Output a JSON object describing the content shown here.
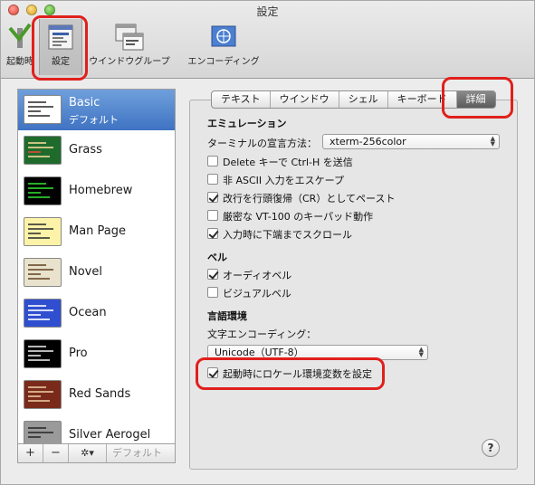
{
  "window": {
    "title": "設定"
  },
  "toolbar": {
    "items": [
      {
        "label": "起動時"
      },
      {
        "label": "設定"
      },
      {
        "label": "ウインドウグループ"
      },
      {
        "label": "エンコーディング"
      }
    ]
  },
  "profiles": [
    {
      "name": "Basic",
      "sub": "デフォルト"
    },
    {
      "name": "Grass"
    },
    {
      "name": "Homebrew"
    },
    {
      "name": "Man Page"
    },
    {
      "name": "Novel"
    },
    {
      "name": "Ocean"
    },
    {
      "name": "Pro"
    },
    {
      "name": "Red Sands"
    },
    {
      "name": "Silver Aerogel"
    }
  ],
  "list_bar": {
    "add": "+",
    "remove": "−",
    "gear": "✲▾",
    "default": "デフォルト"
  },
  "tabs": [
    {
      "label": "テキスト"
    },
    {
      "label": "ウインドウ"
    },
    {
      "label": "シェル"
    },
    {
      "label": "キーボード"
    },
    {
      "label": "詳細"
    }
  ],
  "emulation": {
    "title": "エミュレーション",
    "declare_label": "ターミナルの宣言方法：",
    "declare_value": "xterm-256color",
    "checks": [
      {
        "label": "Delete キーで Ctrl-H を送信",
        "checked": false
      },
      {
        "label": "非 ASCII 入力をエスケープ",
        "checked": false
      },
      {
        "label": "改行を行頭復帰（CR）としてペースト",
        "checked": true
      },
      {
        "label": "厳密な VT-100 のキーパッド動作",
        "checked": false
      },
      {
        "label": "入力時に下端までスクロール",
        "checked": true
      }
    ]
  },
  "bell": {
    "title": "ベル",
    "checks": [
      {
        "label": "オーディオベル",
        "checked": true
      },
      {
        "label": "ビジュアルベル",
        "checked": false
      }
    ]
  },
  "language": {
    "title": "言語環境",
    "encoding_label": "文字エンコーディング：",
    "encoding_value": "Unicode（UTF-8）",
    "locale_check": {
      "label": "起動時にロケール環境変数を設定",
      "checked": true
    }
  },
  "help": {
    "label": "?"
  },
  "colors": {
    "annotation": "#e0201c",
    "selection": "#3f73c2"
  }
}
